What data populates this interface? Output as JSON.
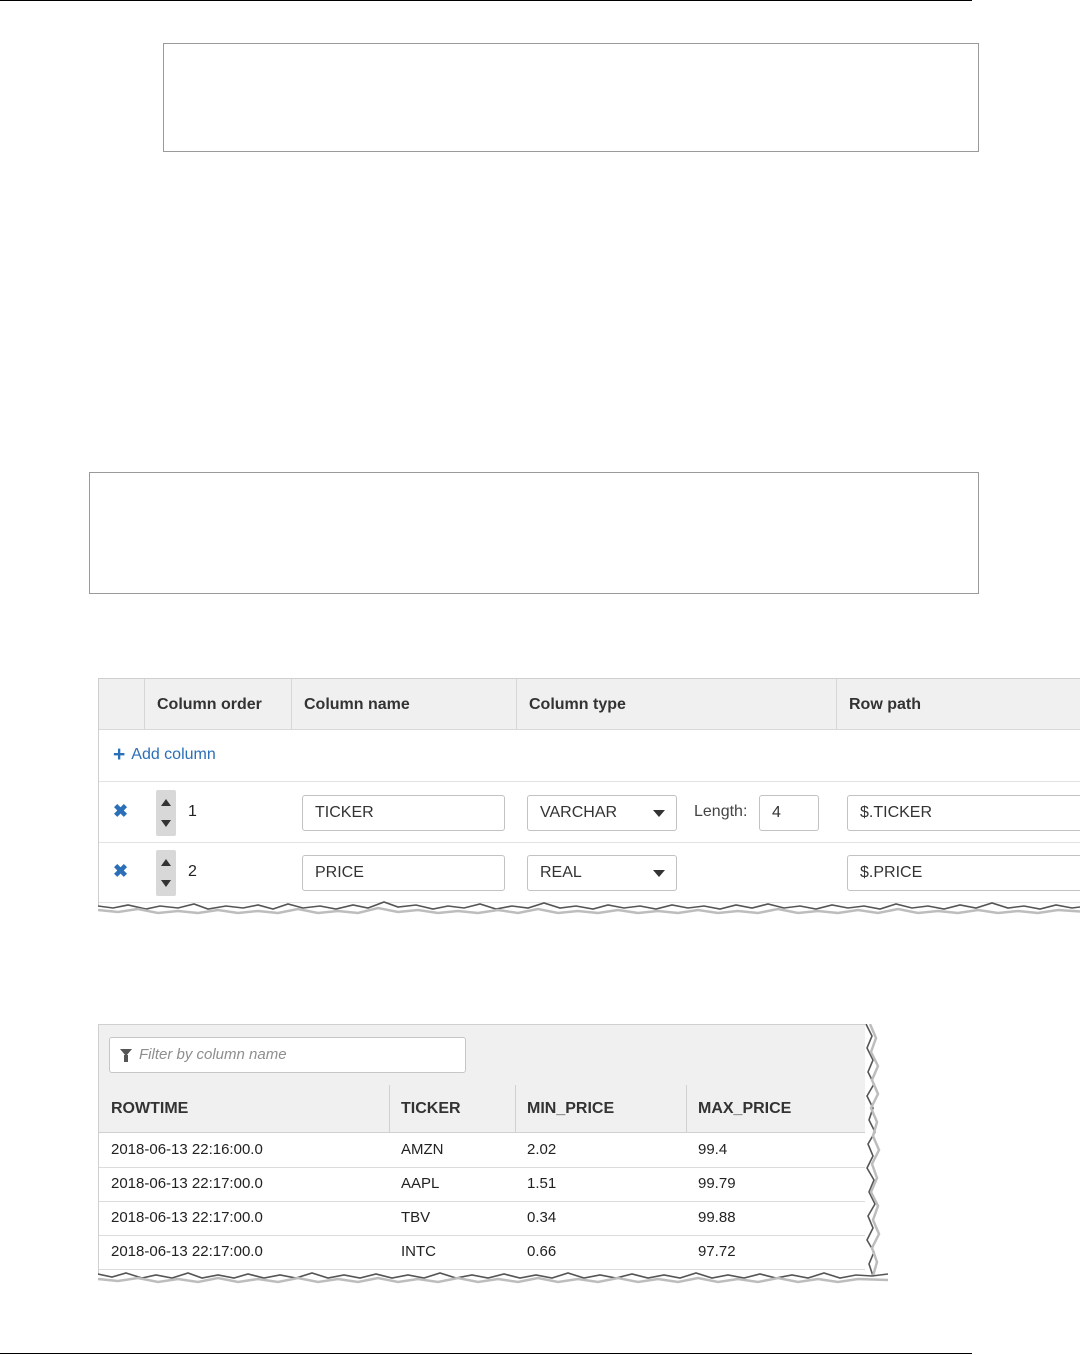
{
  "schema_editor": {
    "headers": [
      "Column order",
      "Column name",
      "Column type",
      "Row path"
    ],
    "add_column_label": "Add column",
    "length_label": "Length:",
    "rows": [
      {
        "order": "1",
        "name": "TICKER",
        "type": "VARCHAR",
        "length": "4",
        "row_path": "$.TICKER"
      },
      {
        "order": "2",
        "name": "PRICE",
        "type": "REAL",
        "length": "",
        "row_path": "$.PRICE"
      }
    ]
  },
  "results": {
    "filter_placeholder": "Filter by column name",
    "headers": [
      "ROWTIME",
      "TICKER",
      "MIN_PRICE",
      "MAX_PRICE"
    ],
    "rows": [
      [
        "2018-06-13 22:16:00.0",
        "AMZN",
        "2.02",
        "99.4"
      ],
      [
        "2018-06-13 22:17:00.0",
        "AAPL",
        "1.51",
        "99.79"
      ],
      [
        "2018-06-13 22:17:00.0",
        "TBV",
        "0.34",
        "99.88"
      ],
      [
        "2018-06-13 22:17:00.0",
        "INTC",
        "0.66",
        "97.72"
      ]
    ]
  },
  "icons": {
    "add": "plus-icon",
    "delete": "close-icon",
    "stepper": "up-down-stepper-icon",
    "dropdown": "caret-down-icon",
    "filter": "funnel-icon"
  },
  "colors": {
    "link_blue": "#2a6fb8",
    "header_bg": "#f0f0f0",
    "border": "#cfcfcf"
  }
}
